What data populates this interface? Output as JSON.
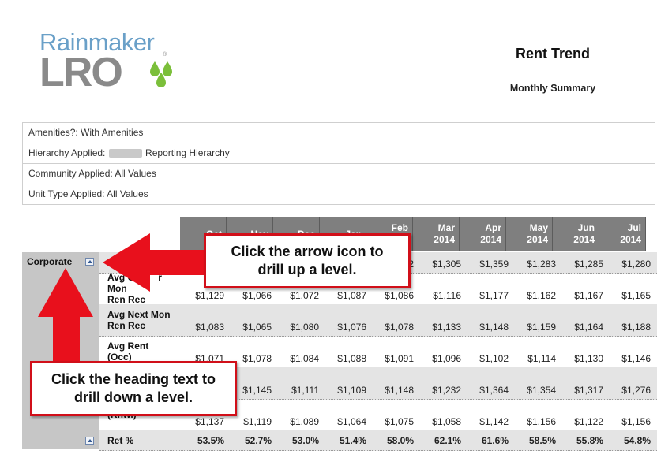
{
  "header": {
    "logo_top": "Rainmaker",
    "logo_bottom": "LRO",
    "logo_reg": "®",
    "title": "Rent Trend",
    "subtitle": "Monthly Summary"
  },
  "filters": {
    "amenities": "Amenities?:  With Amenities",
    "hierarchy_prefix": "Hierarchy Applied: ",
    "hierarchy_suffix": " Reporting Hierarchy",
    "community": "Community Applied: All Values",
    "unit_type": "Unit Type Applied: All Values"
  },
  "columns": [
    {
      "month": "Oct",
      "year": ""
    },
    {
      "month": "Nov",
      "year": ""
    },
    {
      "month": "Dec",
      "year": ""
    },
    {
      "month": "Jan",
      "year": ""
    },
    {
      "month": "Feb",
      "year": "14"
    },
    {
      "month": "Mar",
      "year": "2014"
    },
    {
      "month": "Apr",
      "year": "2014"
    },
    {
      "month": "May",
      "year": "2014"
    },
    {
      "month": "Jun",
      "year": "2014"
    },
    {
      "month": "Jul",
      "year": "2014"
    }
  ],
  "grid": {
    "group_label": "Corporate",
    "rows": [
      {
        "label_1": "",
        "label_2": "",
        "values": [
          "$",
          "",
          "",
          "",
          "02",
          "$1,305",
          "$1,359",
          "$1,283",
          "$1,285",
          "$1,280"
        ]
      },
      {
        "label_1": "Avg C",
        "label_2": "Ren Rec",
        "label_1_end": "r Mon",
        "values": [
          "$1,129",
          "$1,066",
          "$1,072",
          "$1,087",
          "$1,086",
          "$1,116",
          "$1,177",
          "$1,162",
          "$1,167",
          "$1,165"
        ]
      },
      {
        "label_1": "Avg Next Mon",
        "label_2": "Ren Rec",
        "values": [
          "$1,083",
          "$1,065",
          "$1,080",
          "$1,076",
          "$1,078",
          "$1,133",
          "$1,148",
          "$1,159",
          "$1,164",
          "$1,188"
        ]
      },
      {
        "label_1": "Avg Rent",
        "label_2": "(Occ)",
        "values": [
          "$1,071",
          "$1,078",
          "$1,084",
          "$1,088",
          "$1,091",
          "$1,096",
          "$1,102",
          "$1,114",
          "$1,130",
          "$1,146"
        ]
      },
      {
        "label_1": "",
        "label_2": "",
        "values": [
          "",
          "$1,145",
          "$1,111",
          "$1,109",
          "$1,148",
          "$1,232",
          "$1,364",
          "$1,354",
          "$1,317",
          "$1,276"
        ]
      },
      {
        "label_1": "",
        "label_2": "(Rnwl)",
        "values": [
          "$1,137",
          "$1,119",
          "$1,089",
          "$1,064",
          "$1,075",
          "$1,058",
          "$1,142",
          "$1,156",
          "$1,122",
          "$1,156"
        ]
      },
      {
        "label_1": "Ret %",
        "label_2": "",
        "values": [
          "53.5%",
          "52.7%",
          "53.0%",
          "51.4%",
          "58.0%",
          "62.1%",
          "61.6%",
          "58.5%",
          "55.8%",
          "54.8%"
        ]
      }
    ]
  },
  "callouts": {
    "drill_up": [
      "Click the arrow icon to",
      "drill up a level."
    ],
    "drill_down": [
      "Click the heading text to",
      "drill down a level."
    ]
  },
  "colors": {
    "callout_border": "#d10f19",
    "arrow_fill": "#e8101c",
    "header_bg": "#7f7f7f",
    "logo_blue": "#6aa0c8",
    "logo_grey": "#8a8a8a",
    "drop_green": "#7bbf3a"
  }
}
